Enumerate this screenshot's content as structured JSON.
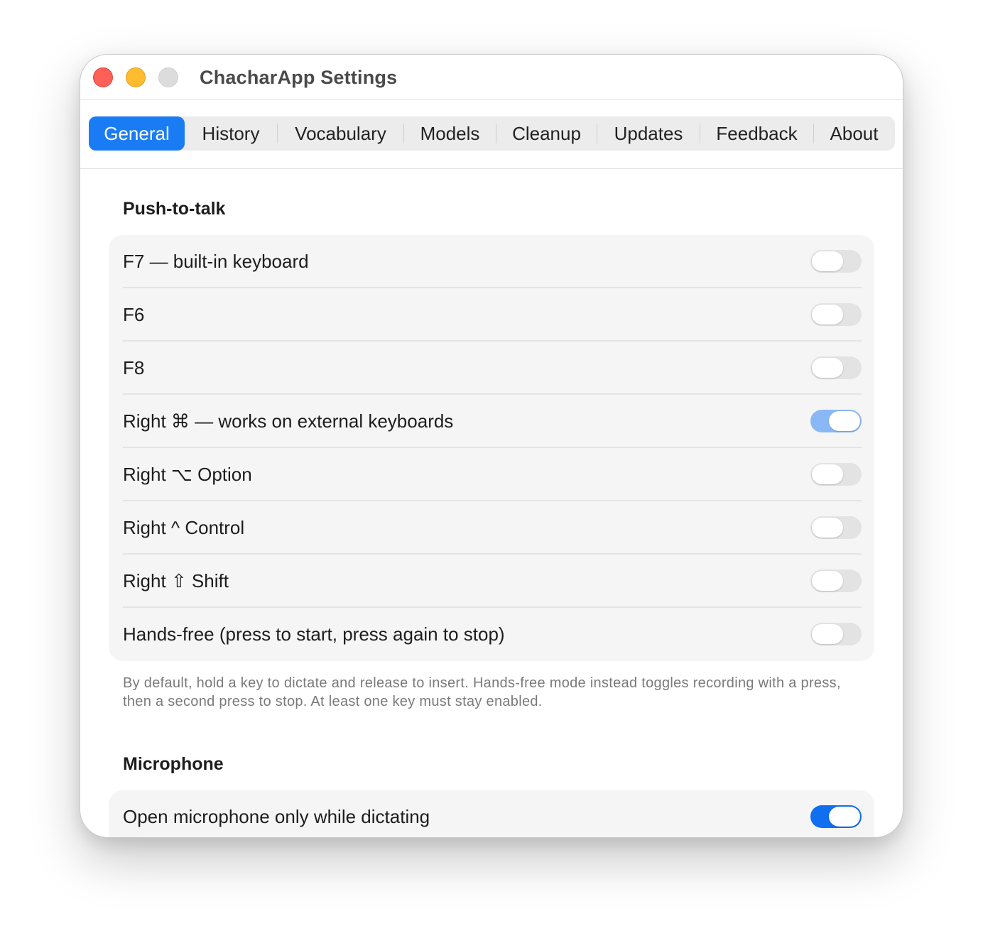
{
  "window": {
    "title": "ChacharApp Settings"
  },
  "tabs": [
    {
      "label": "General",
      "active": true
    },
    {
      "label": "History",
      "active": false
    },
    {
      "label": "Vocabulary",
      "active": false
    },
    {
      "label": "Models",
      "active": false
    },
    {
      "label": "Cleanup",
      "active": false
    },
    {
      "label": "Updates",
      "active": false
    },
    {
      "label": "Feedback",
      "active": false
    },
    {
      "label": "About",
      "active": false
    }
  ],
  "push_to_talk": {
    "heading": "Push-to-talk",
    "items": [
      {
        "label": "F7 — built-in keyboard",
        "enabled": false
      },
      {
        "label": "F6",
        "enabled": false
      },
      {
        "label": "F8",
        "enabled": false
      },
      {
        "label": "Right ⌘ — works on external keyboards",
        "enabled": true
      },
      {
        "label": "Right ⌥ Option",
        "enabled": false
      },
      {
        "label": "Right ^ Control",
        "enabled": false
      },
      {
        "label": "Right ⇧ Shift",
        "enabled": false
      },
      {
        "label": "Hands-free (press to start, press again to stop)",
        "enabled": false
      }
    ],
    "footnote": "By default, hold a key to dictate and release to insert. Hands-free mode instead toggles recording with a press, then a second press to stop. At least one key must stay enabled."
  },
  "microphone": {
    "heading": "Microphone",
    "items": [
      {
        "label": "Open microphone only while dictating",
        "enabled": true
      }
    ]
  },
  "colors": {
    "accent": "#1a7cf5",
    "toggle_on_light": "#8ab8f6",
    "toggle_on_strong": "#0f6ff0",
    "toggle_off": "#e3e3e3",
    "traffic_close": "#fe5f57",
    "traffic_minimize": "#febc2e",
    "traffic_zoom": "#dcdcdc"
  }
}
